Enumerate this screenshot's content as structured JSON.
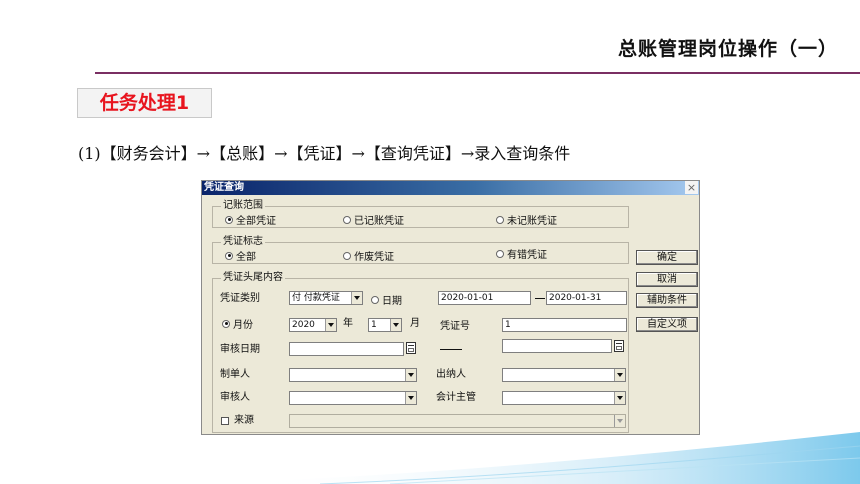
{
  "slide": {
    "title": "总账管理岗位操作（一）",
    "task_label": "任务处理1",
    "instruction": "(1)【财务会计】→【总账】→【凭证】→【查询凭证】→录入查询条件"
  },
  "dialog": {
    "title": "凭证查询",
    "close_glyph": "×",
    "range": {
      "legend": "记账范围",
      "options": [
        "全部凭证",
        "已记账凭证",
        "未记账凭证"
      ],
      "selected_index": 0
    },
    "flag": {
      "legend": "凭证标志",
      "options": [
        "全部",
        "作废凭证",
        "有错凭证"
      ],
      "selected_index": 0
    },
    "header": {
      "legend": "凭证头尾内容",
      "type_label": "凭证类别",
      "type_value": "付 付款凭证",
      "date_radio": "日期",
      "date_from": "2020-01-01",
      "date_to": "2020-01-31",
      "month_radio": "月份",
      "year_value": "2020",
      "year_unit": "年",
      "month_value": "1",
      "month_unit": "月",
      "voucher_no_label": "凭证号",
      "voucher_no_value": "1",
      "audit_date_label": "审核日期",
      "maker_label": "制单人",
      "cashier_label": "出纳人",
      "auditor_label": "审核人",
      "supervisor_label": "会计主管",
      "source_label": "来源"
    },
    "buttons": {
      "ok": "确定",
      "cancel": "取消",
      "aux": "辅助条件",
      "custom": "自定义项"
    }
  },
  "colors": {
    "title_rule": "#7a2f63",
    "task_text": "#e8141e",
    "titlebar_start": "#0a246a",
    "dialog_bg": "#ece9d8"
  }
}
